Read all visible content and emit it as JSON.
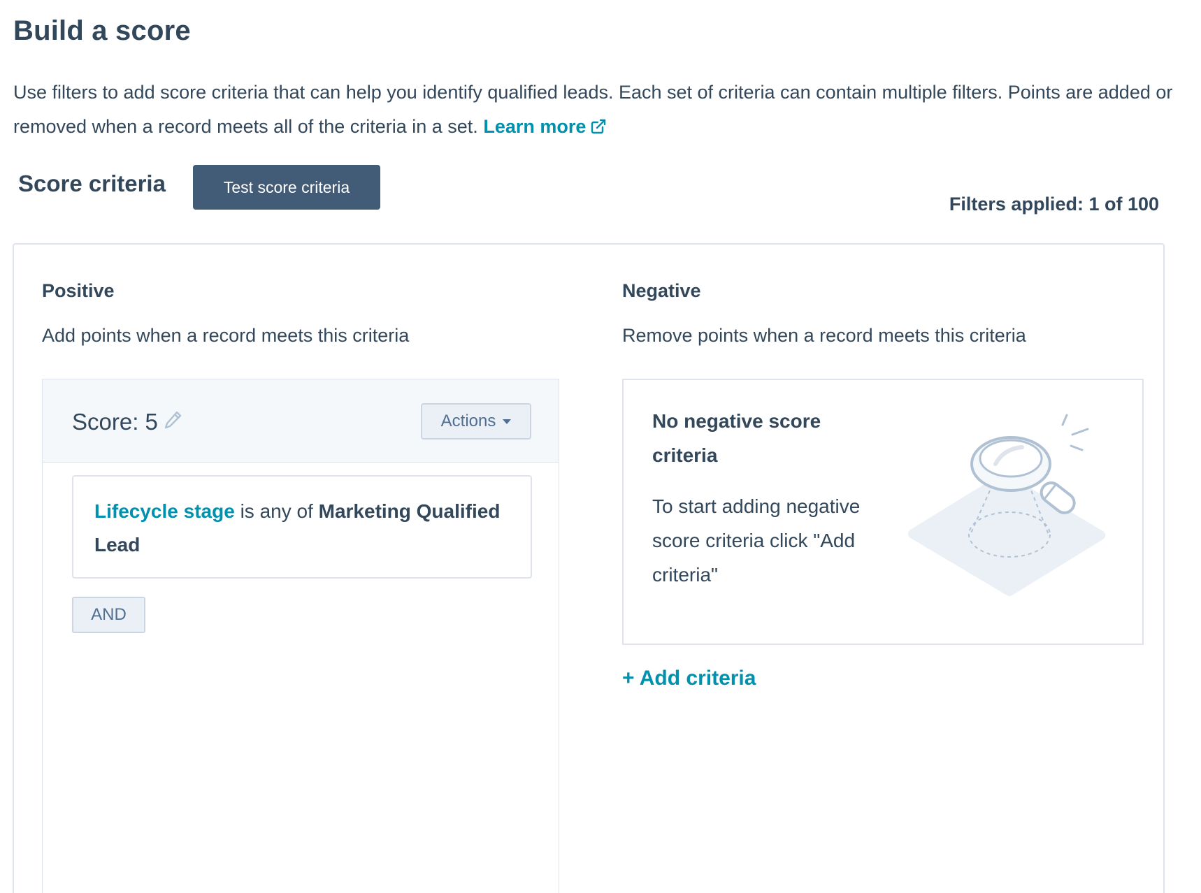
{
  "page": {
    "title": "Build a score",
    "intro_text": "Use filters to add score criteria that can help you identify qualified leads. Each set of criteria can contain multiple filters. Points are added or removed when a record meets all of the criteria in a set.",
    "learn_more_label": "Learn more",
    "learn_more_icon": "external-link-icon"
  },
  "score_criteria": {
    "heading": "Score criteria",
    "test_button_label": "Test score criteria",
    "filters_applied": "Filters applied: 1 of 100"
  },
  "positive": {
    "title": "Positive",
    "description": "Add points when a record meets this criteria",
    "group": {
      "score_label": "Score: 5",
      "edit_icon": "pencil-icon",
      "actions_label": "Actions",
      "filter": {
        "property": "Lifecycle stage",
        "operator": "is any of",
        "value": "Marketing Qualified Lead"
      },
      "and_label": "AND"
    }
  },
  "negative": {
    "title": "Negative",
    "description": "Remove points when a record meets this criteria",
    "empty_title": "No negative score criteria",
    "empty_description": "To start adding negative score criteria click \"Add criteria\"",
    "illustration_icon": "magnifying-glass-icon",
    "add_criteria_label": "+ Add criteria"
  },
  "colors": {
    "text": "#33475b",
    "accent": "#0091ae",
    "primary_button": "#425b76",
    "border": "#dfe3eb",
    "header_bg": "#f5f8fa"
  }
}
